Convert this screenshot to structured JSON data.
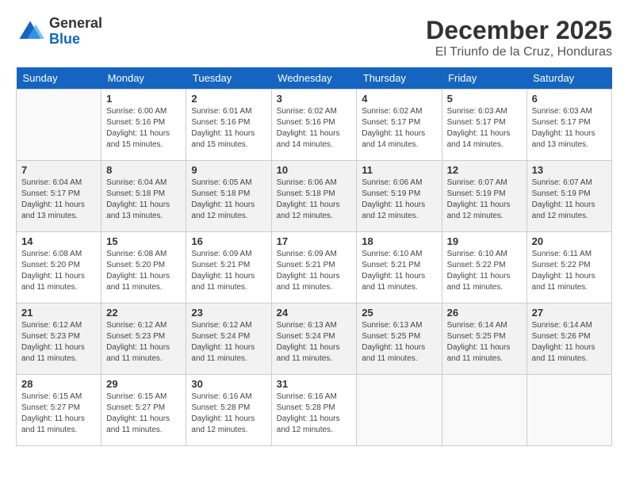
{
  "header": {
    "logo_general": "General",
    "logo_blue": "Blue",
    "month_year": "December 2025",
    "location": "El Triunfo de la Cruz, Honduras"
  },
  "days_of_week": [
    "Sunday",
    "Monday",
    "Tuesday",
    "Wednesday",
    "Thursday",
    "Friday",
    "Saturday"
  ],
  "weeks": [
    [
      {
        "day": "",
        "info": ""
      },
      {
        "day": "1",
        "info": "Sunrise: 6:00 AM\nSunset: 5:16 PM\nDaylight: 11 hours\nand 15 minutes."
      },
      {
        "day": "2",
        "info": "Sunrise: 6:01 AM\nSunset: 5:16 PM\nDaylight: 11 hours\nand 15 minutes."
      },
      {
        "day": "3",
        "info": "Sunrise: 6:02 AM\nSunset: 5:16 PM\nDaylight: 11 hours\nand 14 minutes."
      },
      {
        "day": "4",
        "info": "Sunrise: 6:02 AM\nSunset: 5:17 PM\nDaylight: 11 hours\nand 14 minutes."
      },
      {
        "day": "5",
        "info": "Sunrise: 6:03 AM\nSunset: 5:17 PM\nDaylight: 11 hours\nand 14 minutes."
      },
      {
        "day": "6",
        "info": "Sunrise: 6:03 AM\nSunset: 5:17 PM\nDaylight: 11 hours\nand 13 minutes."
      }
    ],
    [
      {
        "day": "7",
        "info": "Sunrise: 6:04 AM\nSunset: 5:17 PM\nDaylight: 11 hours\nand 13 minutes."
      },
      {
        "day": "8",
        "info": "Sunrise: 6:04 AM\nSunset: 5:18 PM\nDaylight: 11 hours\nand 13 minutes."
      },
      {
        "day": "9",
        "info": "Sunrise: 6:05 AM\nSunset: 5:18 PM\nDaylight: 11 hours\nand 12 minutes."
      },
      {
        "day": "10",
        "info": "Sunrise: 6:06 AM\nSunset: 5:18 PM\nDaylight: 11 hours\nand 12 minutes."
      },
      {
        "day": "11",
        "info": "Sunrise: 6:06 AM\nSunset: 5:19 PM\nDaylight: 11 hours\nand 12 minutes."
      },
      {
        "day": "12",
        "info": "Sunrise: 6:07 AM\nSunset: 5:19 PM\nDaylight: 11 hours\nand 12 minutes."
      },
      {
        "day": "13",
        "info": "Sunrise: 6:07 AM\nSunset: 5:19 PM\nDaylight: 11 hours\nand 12 minutes."
      }
    ],
    [
      {
        "day": "14",
        "info": "Sunrise: 6:08 AM\nSunset: 5:20 PM\nDaylight: 11 hours\nand 11 minutes."
      },
      {
        "day": "15",
        "info": "Sunrise: 6:08 AM\nSunset: 5:20 PM\nDaylight: 11 hours\nand 11 minutes."
      },
      {
        "day": "16",
        "info": "Sunrise: 6:09 AM\nSunset: 5:21 PM\nDaylight: 11 hours\nand 11 minutes."
      },
      {
        "day": "17",
        "info": "Sunrise: 6:09 AM\nSunset: 5:21 PM\nDaylight: 11 hours\nand 11 minutes."
      },
      {
        "day": "18",
        "info": "Sunrise: 6:10 AM\nSunset: 5:21 PM\nDaylight: 11 hours\nand 11 minutes."
      },
      {
        "day": "19",
        "info": "Sunrise: 6:10 AM\nSunset: 5:22 PM\nDaylight: 11 hours\nand 11 minutes."
      },
      {
        "day": "20",
        "info": "Sunrise: 6:11 AM\nSunset: 5:22 PM\nDaylight: 11 hours\nand 11 minutes."
      }
    ],
    [
      {
        "day": "21",
        "info": "Sunrise: 6:12 AM\nSunset: 5:23 PM\nDaylight: 11 hours\nand 11 minutes."
      },
      {
        "day": "22",
        "info": "Sunrise: 6:12 AM\nSunset: 5:23 PM\nDaylight: 11 hours\nand 11 minutes."
      },
      {
        "day": "23",
        "info": "Sunrise: 6:12 AM\nSunset: 5:24 PM\nDaylight: 11 hours\nand 11 minutes."
      },
      {
        "day": "24",
        "info": "Sunrise: 6:13 AM\nSunset: 5:24 PM\nDaylight: 11 hours\nand 11 minutes."
      },
      {
        "day": "25",
        "info": "Sunrise: 6:13 AM\nSunset: 5:25 PM\nDaylight: 11 hours\nand 11 minutes."
      },
      {
        "day": "26",
        "info": "Sunrise: 6:14 AM\nSunset: 5:25 PM\nDaylight: 11 hours\nand 11 minutes."
      },
      {
        "day": "27",
        "info": "Sunrise: 6:14 AM\nSunset: 5:26 PM\nDaylight: 11 hours\nand 11 minutes."
      }
    ],
    [
      {
        "day": "28",
        "info": "Sunrise: 6:15 AM\nSunset: 5:27 PM\nDaylight: 11 hours\nand 11 minutes."
      },
      {
        "day": "29",
        "info": "Sunrise: 6:15 AM\nSunset: 5:27 PM\nDaylight: 11 hours\nand 11 minutes."
      },
      {
        "day": "30",
        "info": "Sunrise: 6:16 AM\nSunset: 5:28 PM\nDaylight: 11 hours\nand 12 minutes."
      },
      {
        "day": "31",
        "info": "Sunrise: 6:16 AM\nSunset: 5:28 PM\nDaylight: 11 hours\nand 12 minutes."
      },
      {
        "day": "",
        "info": ""
      },
      {
        "day": "",
        "info": ""
      },
      {
        "day": "",
        "info": ""
      }
    ]
  ]
}
